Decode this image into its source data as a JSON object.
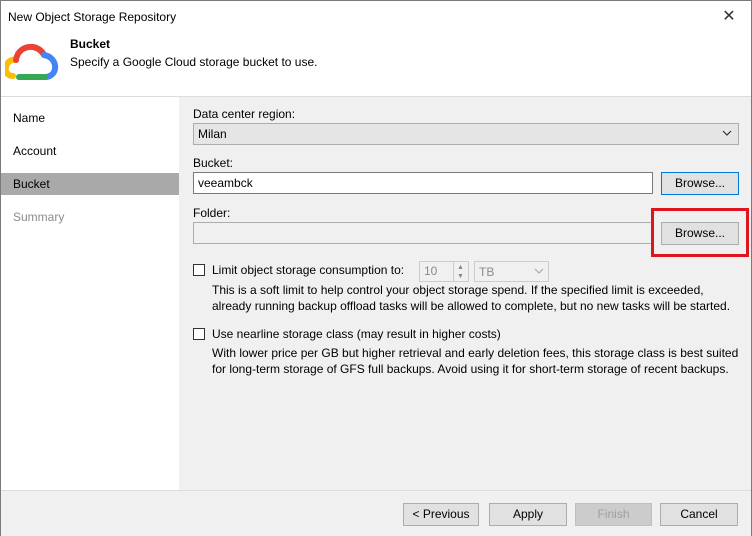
{
  "window": {
    "title": "New Object Storage Repository",
    "close_glyph": "✕"
  },
  "header": {
    "title": "Bucket",
    "subtitle": "Specify a Google Cloud storage bucket to use.",
    "logo_icon": "google-cloud-icon"
  },
  "sidebar": {
    "items": [
      {
        "label": "Name",
        "state": "normal"
      },
      {
        "label": "Account",
        "state": "normal"
      },
      {
        "label": "Bucket",
        "state": "active"
      },
      {
        "label": "Summary",
        "state": "disabled"
      }
    ]
  },
  "form": {
    "region_label": "Data center region:",
    "region_value": "Milan",
    "bucket_label": "Bucket:",
    "bucket_value": "veeambck",
    "bucket_browse": "Browse...",
    "folder_label": "Folder:",
    "folder_value": "",
    "folder_browse": "Browse...",
    "limit_label": "Limit object storage consumption to:",
    "limit_checked": false,
    "limit_value": "10",
    "limit_unit": "TB",
    "limit_desc_1": "This is a soft limit to help control your object storage spend. If the specified limit is exceeded,",
    "limit_desc_2": "already running backup offload tasks will be allowed to complete, but no new tasks will be started.",
    "nearline_label": "Use nearline storage class (may result in higher costs)",
    "nearline_checked": false,
    "nearline_desc_1": "With lower price per GB but higher retrieval and early deletion fees, this storage class is best suited",
    "nearline_desc_2": "for long-term storage of GFS full backups. Avoid using it for short-term storage of recent backups."
  },
  "footer": {
    "previous": "< Previous",
    "apply": "Apply",
    "finish": "Finish",
    "cancel": "Cancel"
  },
  "colors": {
    "highlight": "#e0141e",
    "active_nav": "#a9a9a9",
    "focus_border": "#0078d7"
  }
}
